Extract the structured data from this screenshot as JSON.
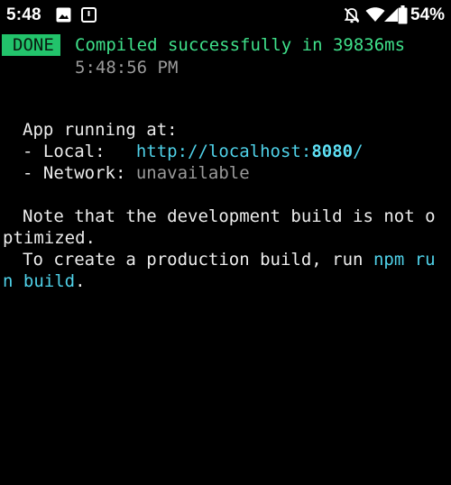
{
  "status_bar": {
    "time": "5:48",
    "battery_percent": "54%",
    "icons": [
      "image-notification-icon",
      "notification-icon",
      "mute-icon",
      "wifi-icon",
      "cell-signal-icon",
      "battery-icon"
    ]
  },
  "terminal": {
    "badge": "DONE",
    "compiled_message": "Compiled successfully in 39836ms",
    "compiled_time": "5:48:56 PM",
    "app_running": "App running at:",
    "local_label": "- Local:   ",
    "local_url_prefix": "http://localhost:",
    "local_port": "8080",
    "local_url_suffix": "/",
    "network_label": "- Network: ",
    "network_value": "unavailable",
    "note_line1": "Note that the development build is not o",
    "note_line2": "ptimized.",
    "prod_line1_prefix": "To create a production build, run ",
    "prod_line1_cmd": "npm ru",
    "prod_line2_cmd": "n build",
    "prod_line2_suffix": "."
  },
  "colors": {
    "background": "#000000",
    "badge_bg": "#22c36b",
    "success_text": "#3fe08a",
    "muted_text": "#9a9a9a",
    "link_text": "#4fd1e8"
  }
}
